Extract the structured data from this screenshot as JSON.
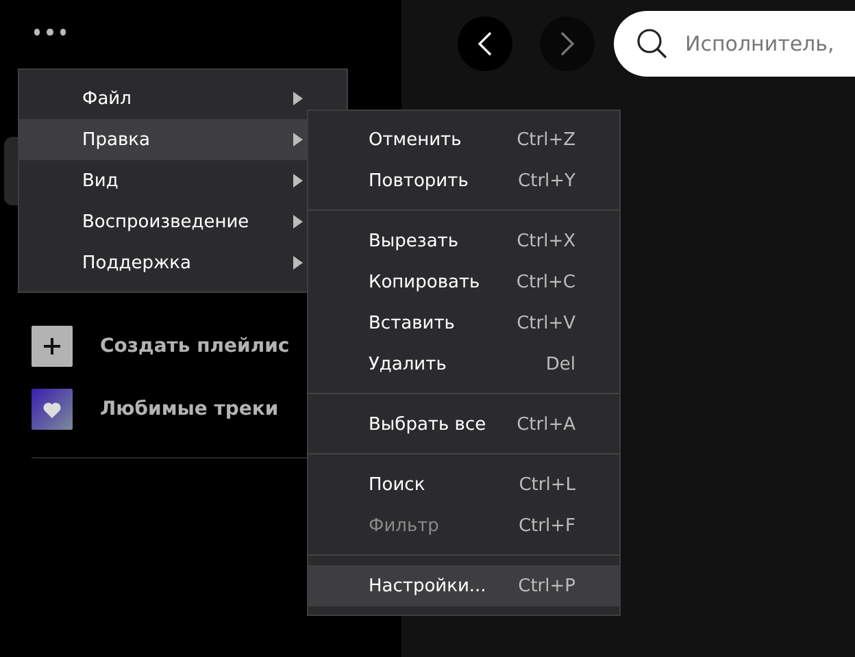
{
  "nav": {
    "back_disabled": false,
    "forward_disabled": true
  },
  "search": {
    "placeholder": "Исполнитель,"
  },
  "sidebar": {
    "items": [
      {
        "kind": "create",
        "label": "Создать плейлис"
      },
      {
        "kind": "liked",
        "label": "Любимые треки"
      }
    ]
  },
  "menu": {
    "items": [
      {
        "label": "Файл",
        "selected": false
      },
      {
        "label": "Правка",
        "selected": true
      },
      {
        "label": "Вид",
        "selected": false
      },
      {
        "label": "Воспроизведение",
        "selected": false
      },
      {
        "label": "Поддержка",
        "selected": false
      }
    ]
  },
  "submenu": {
    "groups": [
      [
        {
          "label": "Отменить",
          "shortcut": "Ctrl+Z",
          "disabled": false,
          "selected": false
        },
        {
          "label": "Повторить",
          "shortcut": "Ctrl+Y",
          "disabled": false,
          "selected": false
        }
      ],
      [
        {
          "label": "Вырезать",
          "shortcut": "Ctrl+X",
          "disabled": false,
          "selected": false
        },
        {
          "label": "Копировать",
          "shortcut": "Ctrl+C",
          "disabled": false,
          "selected": false
        },
        {
          "label": "Вставить",
          "shortcut": "Ctrl+V",
          "disabled": false,
          "selected": false
        },
        {
          "label": "Удалить",
          "shortcut": "Del",
          "disabled": false,
          "selected": false
        }
      ],
      [
        {
          "label": "Выбрать все",
          "shortcut": "Ctrl+A",
          "disabled": false,
          "selected": false
        }
      ],
      [
        {
          "label": "Поиск",
          "shortcut": "Ctrl+L",
          "disabled": false,
          "selected": false
        },
        {
          "label": "Фильтр",
          "shortcut": "Ctrl+F",
          "disabled": true,
          "selected": false
        }
      ],
      [
        {
          "label": "Настройки...",
          "shortcut": "Ctrl+P",
          "disabled": false,
          "selected": true
        }
      ]
    ]
  }
}
